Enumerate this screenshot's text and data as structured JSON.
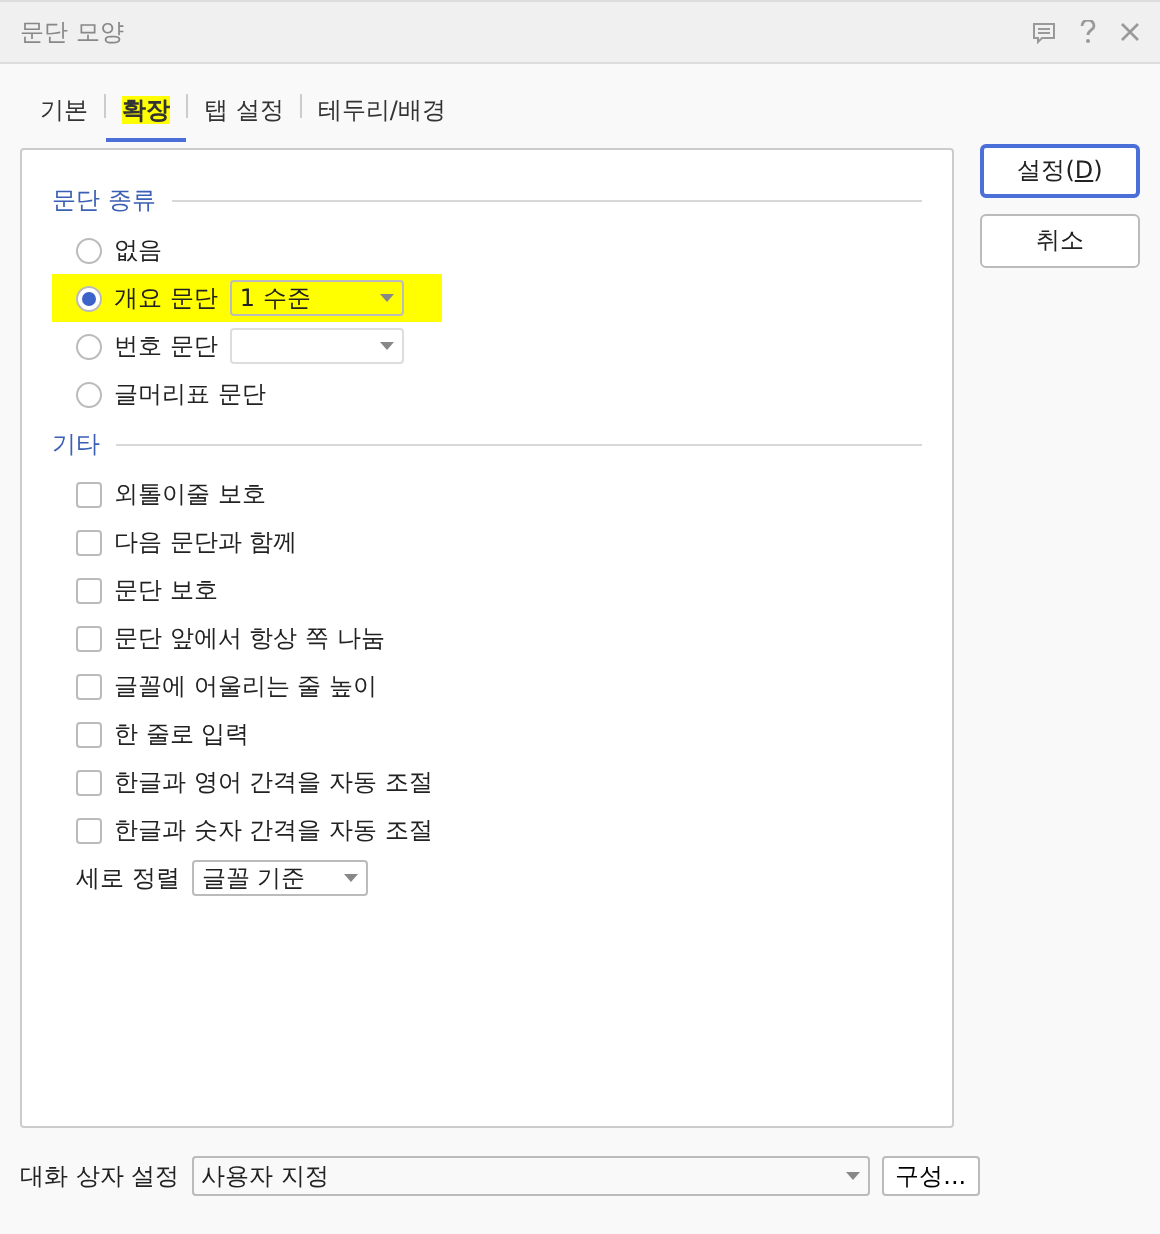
{
  "window": {
    "title": "문단 모양"
  },
  "tabs": [
    {
      "label": "기본",
      "selected": false,
      "highlighted": false
    },
    {
      "label": "확장",
      "selected": true,
      "highlighted": true
    },
    {
      "label": "탭 설정",
      "selected": false,
      "highlighted": false
    },
    {
      "label": "테두리/배경",
      "selected": false,
      "highlighted": false
    }
  ],
  "paragraph_type": {
    "heading": "문단 종류",
    "options": [
      {
        "label": "없음",
        "selected": false,
        "highlighted": false
      },
      {
        "label": "개요 문단",
        "selected": true,
        "highlighted": true,
        "dropdown": {
          "value": "1 수준",
          "disabled": false
        }
      },
      {
        "label": "번호 문단",
        "selected": false,
        "highlighted": false,
        "dropdown": {
          "disabled": true
        }
      },
      {
        "label": "글머리표 문단",
        "selected": false,
        "highlighted": false
      }
    ]
  },
  "other": {
    "heading": "기타",
    "checkboxes": [
      {
        "label": "외톨이줄 보호",
        "checked": false
      },
      {
        "label": "다음 문단과 함께",
        "checked": false
      },
      {
        "label": "문단 보호",
        "checked": false
      },
      {
        "label": "문단 앞에서 항상 쪽 나눔",
        "checked": false
      },
      {
        "label": "글꼴에 어울리는 줄 높이",
        "checked": false
      },
      {
        "label": "한 줄로 입력",
        "checked": false
      },
      {
        "label": "한글과 영어 간격을 자동 조절",
        "checked": false
      },
      {
        "label": "한글과 숫자 간격을 자동 조절",
        "checked": false
      }
    ],
    "vertical_align": {
      "label": "세로 정렬",
      "value": "글꼴 기준"
    }
  },
  "buttons": [
    {
      "label": "설정(",
      "mnemonic": "D",
      "suffix": ")",
      "default": true
    },
    {
      "label": "취소",
      "default": false
    }
  ],
  "footer": {
    "label": "대화 상자 설정",
    "value": "사용자 지정",
    "button": "구성..."
  }
}
